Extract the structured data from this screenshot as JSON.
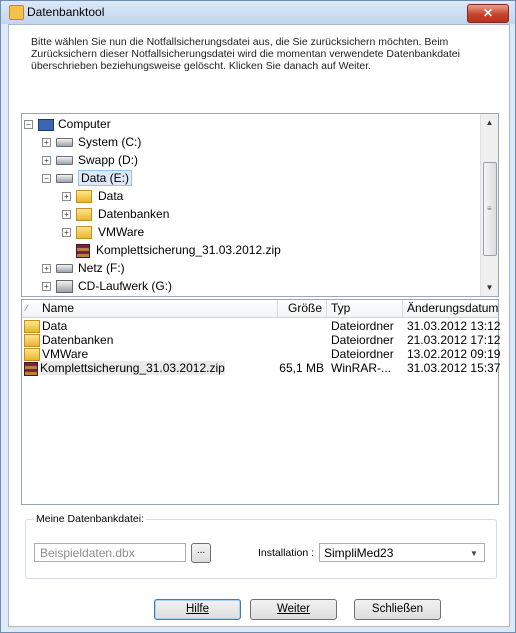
{
  "window": {
    "title": "Datenbanktool",
    "close_label": "✕"
  },
  "info_text": "Bitte wählen Sie nun die Notfallsicherungsdatei aus, die Sie zurücksichern möchten. Beim Zurücksichern dieser Notfallsicherungsdatei wird die momentan verwendete Datenbankdatei überschrieben beziehungsweise gelöscht. Klicken Sie danach auf Weiter.",
  "tree": {
    "items": [
      {
        "label": "Computer",
        "icon": "computer-icon"
      },
      {
        "label": "System (C:)",
        "icon": "drive-icon"
      },
      {
        "label": "Swapp (D:)",
        "icon": "drive-icon"
      },
      {
        "label": "Data (E:)",
        "icon": "drive-icon"
      },
      {
        "label": "Data",
        "icon": "folder-icon"
      },
      {
        "label": "Datenbanken",
        "icon": "folder-icon"
      },
      {
        "label": "VMWare",
        "icon": "folder-icon"
      },
      {
        "label": "Komplettsicherung_31.03.2012.zip",
        "icon": "winrar-archive-icon"
      },
      {
        "label": "Netz (F:)",
        "icon": "network-drive-icon"
      },
      {
        "label": "CD-Laufwerk (G:)",
        "icon": "cd-drive-icon"
      }
    ]
  },
  "file_list": {
    "columns": [
      "Name",
      "Größe",
      "Typ",
      "Änderungsdatum"
    ],
    "rows": [
      {
        "name": "Data",
        "size": "",
        "type": "Dateiordner",
        "date": "31.03.2012 13:12",
        "icon": "folder-icon"
      },
      {
        "name": "Datenbanken",
        "size": "",
        "type": "Dateiordner",
        "date": "21.03.2012 17:12",
        "icon": "folder-icon"
      },
      {
        "name": "VMWare",
        "size": "",
        "type": "Dateiordner",
        "date": "13.02.2012 09:19",
        "icon": "folder-icon"
      },
      {
        "name": "Komplettsicherung_31.03.2012.zip",
        "size": "65,1 MB",
        "type": "WinRAR-...",
        "date": "31.03.2012 15:37",
        "icon": "winrar-archive-icon"
      }
    ]
  },
  "database": {
    "group_label": "Meine Datenbankdatei:",
    "file_value": "Beispieldaten.dbx",
    "browse_label": "...",
    "installation_label": "Installation :",
    "installation_value": "SimpliMed23"
  },
  "buttons": {
    "help_label": "Hilfe",
    "next_label": "Weiter",
    "close_label": "Schließen"
  },
  "colors": {
    "title_bar": "#c3d6ee",
    "close_button": "#c8432c",
    "selection": "#dde9fb"
  }
}
